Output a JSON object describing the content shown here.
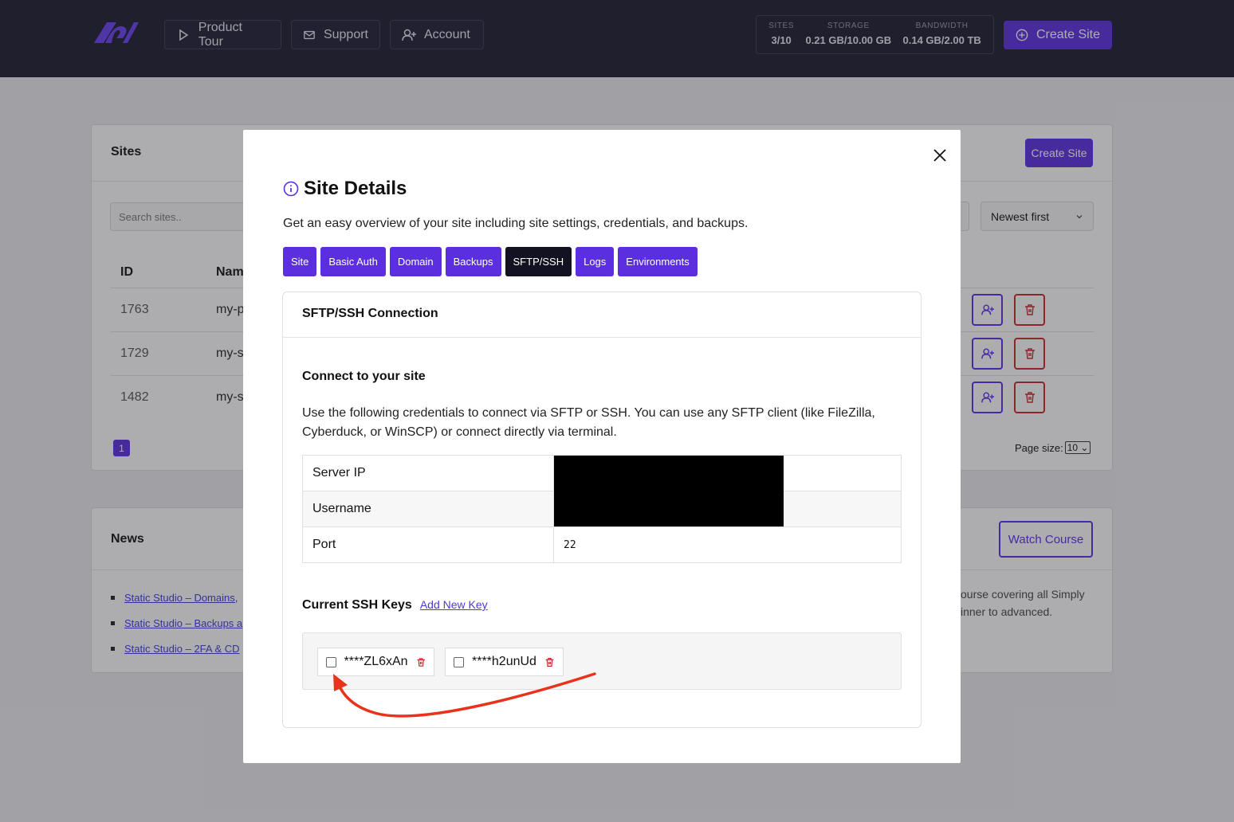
{
  "nav": {
    "product_tour": "Product Tour",
    "support": "Support",
    "account": "Account",
    "create_site": "Create Site"
  },
  "stats": [
    {
      "label": "SITES",
      "value": "3/10"
    },
    {
      "label": "STORAGE",
      "value": "0.21 GB/10.00 GB"
    },
    {
      "label": "BANDWIDTH",
      "value": "0.14 GB/2.00 TB"
    }
  ],
  "sites": {
    "title": "Sites",
    "create_button": "Create Site",
    "search_placeholder": "Search sites..",
    "sort_value": "Newest first",
    "columns": {
      "id": "ID",
      "name": "Nam"
    },
    "rows": [
      {
        "id": "1763",
        "name": "my-p"
      },
      {
        "id": "1729",
        "name": "my-s"
      },
      {
        "id": "1482",
        "name": "my-s"
      }
    ],
    "page": "1",
    "page_size_label": "Page size:",
    "page_size_value": "10"
  },
  "news": {
    "title": "News",
    "watch_button": "Watch Course",
    "items": [
      "Static Studio – Domains,",
      "Static Studio – Backups a",
      "Static Studio – 2FA & CD"
    ],
    "text_line1": "ourse covering all Simply",
    "text_line2": "inner to advanced."
  },
  "modal": {
    "title": "Site Details",
    "subtitle": "Get an easy overview of your site including site settings, credentials, and backups.",
    "tabs": [
      "Site",
      "Basic Auth",
      "Domain",
      "Backups",
      "SFTP/SSH",
      "Logs",
      "Environments"
    ],
    "active_tab": "SFTP/SSH",
    "card_title": "SFTP/SSH Connection",
    "connect_heading": "Connect to your site",
    "connect_desc": "Use the following credentials to connect via SFTP or SSH. You can use any SFTP client (like FileZilla, Cyberduck, or WinSCP) or connect directly via terminal.",
    "credentials": [
      {
        "key": "Server IP",
        "value": ""
      },
      {
        "key": "Username",
        "value": ""
      },
      {
        "key": "Port",
        "value": "22"
      }
    ],
    "keys_heading": "Current SSH Keys",
    "add_key_link": "Add New Key",
    "ssh_keys": [
      "****ZL6xAn",
      "****h2unUd"
    ]
  },
  "colors": {
    "accent": "#5b2ee0",
    "danger": "#c62828",
    "annotation_arrow": "#e8321c",
    "topbar": "#1a1a2e"
  }
}
